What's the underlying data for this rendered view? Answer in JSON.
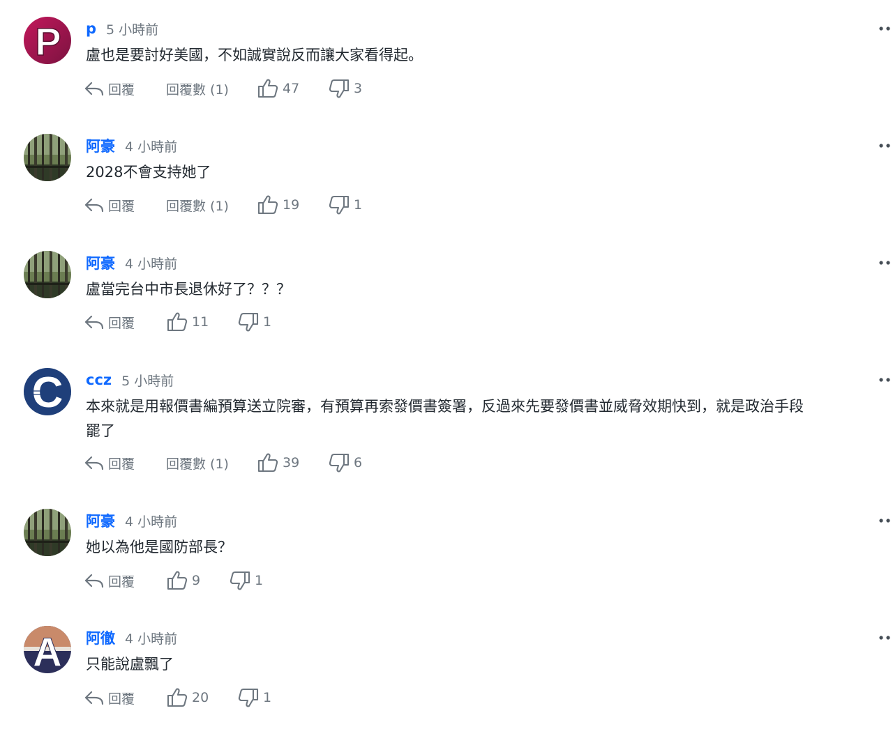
{
  "labels": {
    "reply": "回覆",
    "reply_count_prefix": "回覆數"
  },
  "colors": {
    "username": "#0f69ff",
    "meta_gray": "#6e7780",
    "text": "#232a31"
  },
  "comments": [
    {
      "avatar": "letter-p",
      "username": "p",
      "time": "5 小時前",
      "lines": [
        "盧也是要討好美國，不如誠實說反而讓大家看得起。"
      ],
      "reply_count": "回覆數 (1)",
      "likes": "47",
      "dislikes": "3"
    },
    {
      "avatar": "photo-forest",
      "username": "阿豪",
      "time": "4 小時前",
      "lines": [
        "2028不會支持她了"
      ],
      "reply_count": "回覆數 (1)",
      "likes": "19",
      "dislikes": "1"
    },
    {
      "avatar": "photo-forest",
      "username": "阿豪",
      "time": "4 小時前",
      "lines": [
        "盧當完台中市長退休好了？？？"
      ],
      "reply_count": null,
      "likes": "11",
      "dislikes": "1"
    },
    {
      "avatar": "letter-c",
      "username": "ccz",
      "time": "5 小時前",
      "lines": [
        "本來就是用報價書編預算送立院審，有預算再索發價書簽署，反過來先要發價書並威脅效期快到，就是政治手段",
        "罷了"
      ],
      "reply_count": "回覆數 (1)",
      "likes": "39",
      "dislikes": "6"
    },
    {
      "avatar": "photo-forest",
      "username": "阿豪",
      "time": "4 小時前",
      "lines": [
        "她以為他是國防部長？"
      ],
      "reply_count": null,
      "likes": "9",
      "dislikes": "1"
    },
    {
      "avatar": "letter-a",
      "username": "阿徹",
      "time": "4 小時前",
      "lines": [
        "只能說盧飄了"
      ],
      "reply_count": null,
      "likes": "20",
      "dislikes": "1"
    }
  ]
}
